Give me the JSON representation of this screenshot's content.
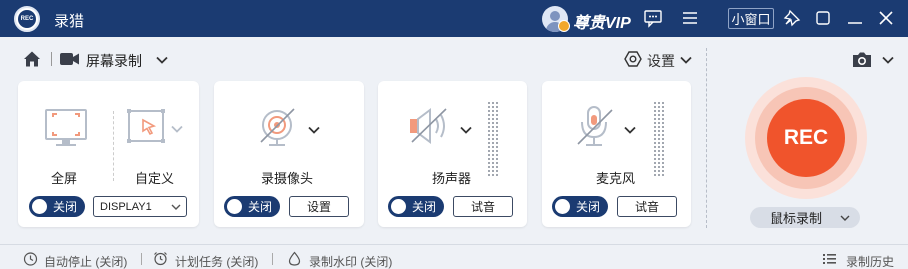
{
  "app": {
    "title": "录猎",
    "logo_text": "REC",
    "vip_text": "尊贵VIP",
    "mini_window": "小窗口"
  },
  "toolbar": {
    "mode": "屏幕录制",
    "settings": "设置"
  },
  "cards": {
    "screen": {
      "full_label": "全屏",
      "custom_label": "自定义",
      "toggle": "关闭",
      "display": "DISPLAY1"
    },
    "camera": {
      "label": "录摄像头",
      "toggle": "关闭",
      "button": "设置"
    },
    "speaker": {
      "label": "扬声器",
      "toggle": "关闭",
      "button": "试音"
    },
    "mic": {
      "label": "麦克风",
      "toggle": "关闭",
      "button": "试音"
    }
  },
  "rec": {
    "label": "REC",
    "mode": "鼠标录制"
  },
  "status": {
    "auto_stop": "自动停止 (关闭)",
    "schedule": "计划任务 (关闭)",
    "watermark": "录制水印 (关闭)",
    "history": "录制历史"
  },
  "colors": {
    "titlebar": "#1b3b72",
    "rec": "#f0542c",
    "accent_orange": "#f29a7d"
  }
}
